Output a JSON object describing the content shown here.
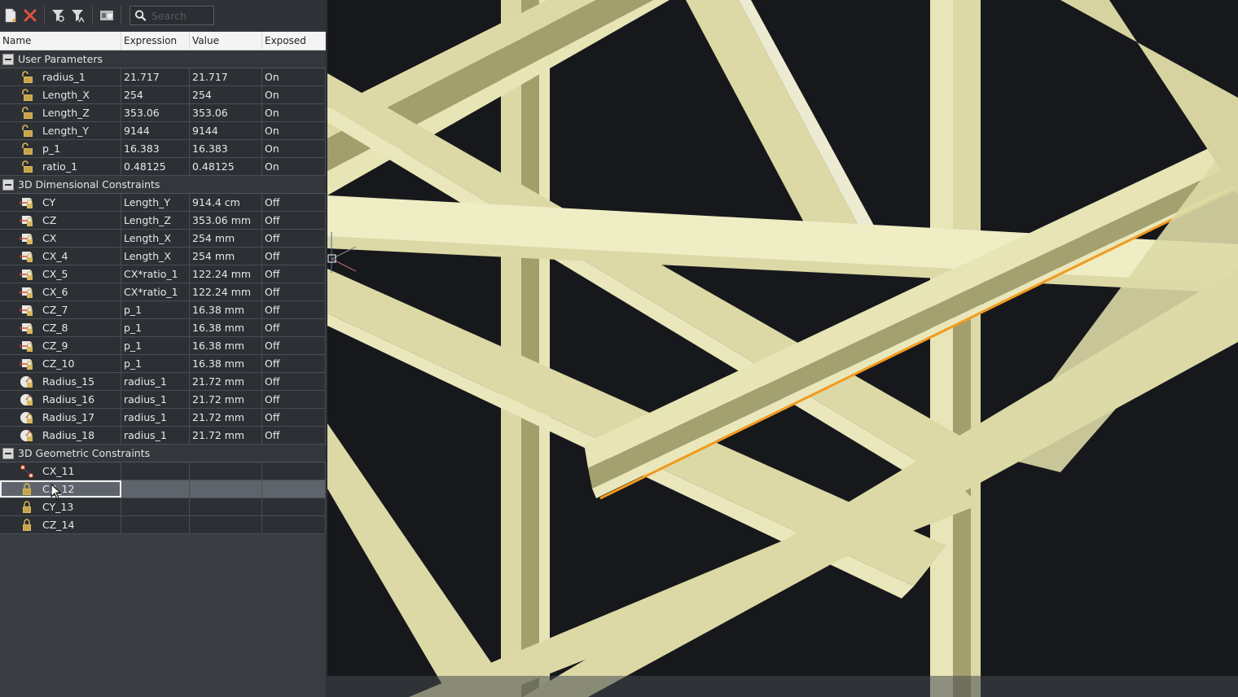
{
  "toolbar": {
    "buttons": [
      {
        "name": "new-parameter",
        "icon": "new-document-icon"
      },
      {
        "name": "delete",
        "icon": "delete-x-icon"
      },
      {
        "name": "filter",
        "icon": "filter-icon"
      },
      {
        "name": "filter-clear",
        "icon": "filter-clear-icon"
      },
      {
        "name": "manage",
        "icon": "manager-icon"
      }
    ],
    "search_placeholder": "Search",
    "search_value": ""
  },
  "columns": [
    "Name",
    "Expression",
    "Value",
    "Exposed"
  ],
  "groups": [
    {
      "label": "User Parameters",
      "icon": "unlocked-parameter-icon",
      "rows": [
        {
          "name": "radius_1",
          "expression": "21.717",
          "value": "21.717",
          "exposed": "On"
        },
        {
          "name": "Length_X",
          "expression": "254",
          "value": "254",
          "exposed": "On"
        },
        {
          "name": "Length_Z",
          "expression": "353.06",
          "value": "353.06",
          "exposed": "On"
        },
        {
          "name": "Length_Y",
          "expression": "9144",
          "value": "9144",
          "exposed": "On"
        },
        {
          "name": "p_1",
          "expression": "16.383",
          "value": "16.383",
          "exposed": "On"
        },
        {
          "name": "ratio_1",
          "expression": "0.48125",
          "value": "0.48125",
          "exposed": "On"
        }
      ]
    },
    {
      "label": "3D Dimensional Constraints",
      "rows": [
        {
          "name": "CY",
          "expression": "Length_Y",
          "value": "914.4 cm",
          "exposed": "Off",
          "icon": "linear-dimension-icon"
        },
        {
          "name": "CZ",
          "expression": "Length_Z",
          "value": "353.06 mm",
          "exposed": "Off",
          "icon": "linear-dimension-icon"
        },
        {
          "name": "CX",
          "expression": "Length_X",
          "value": "254 mm",
          "exposed": "Off",
          "icon": "linear-dimension-icon"
        },
        {
          "name": "CX_4",
          "expression": "Length_X",
          "value": "254 mm",
          "exposed": "Off",
          "icon": "linear-dimension-icon"
        },
        {
          "name": "CX_5",
          "expression": "CX*ratio_1",
          "value": "122.24 mm",
          "exposed": "Off",
          "icon": "linear-dimension-icon"
        },
        {
          "name": "CX_6",
          "expression": "CX*ratio_1",
          "value": "122.24 mm",
          "exposed": "Off",
          "icon": "linear-dimension-icon"
        },
        {
          "name": "CZ_7",
          "expression": "p_1",
          "value": "16.38 mm",
          "exposed": "Off",
          "icon": "linear-dimension-icon"
        },
        {
          "name": "CZ_8",
          "expression": "p_1",
          "value": "16.38 mm",
          "exposed": "Off",
          "icon": "linear-dimension-icon"
        },
        {
          "name": "CZ_9",
          "expression": "p_1",
          "value": "16.38 mm",
          "exposed": "Off",
          "icon": "linear-dimension-icon"
        },
        {
          "name": "CZ_10",
          "expression": "p_1",
          "value": "16.38 mm",
          "exposed": "Off",
          "icon": "linear-dimension-icon"
        },
        {
          "name": "Radius_15",
          "expression": "radius_1",
          "value": "21.72 mm",
          "exposed": "Off",
          "icon": "radius-dimension-icon"
        },
        {
          "name": "Radius_16",
          "expression": "radius_1",
          "value": "21.72 mm",
          "exposed": "Off",
          "icon": "radius-dimension-icon"
        },
        {
          "name": "Radius_17",
          "expression": "radius_1",
          "value": "21.72 mm",
          "exposed": "Off",
          "icon": "radius-dimension-icon"
        },
        {
          "name": "Radius_18",
          "expression": "radius_1",
          "value": "21.72 mm",
          "exposed": "Off",
          "icon": "radius-dimension-icon"
        }
      ]
    },
    {
      "label": "3D Geometric Constraints",
      "rows": [
        {
          "name": "CX_11",
          "expression": "",
          "value": "",
          "exposed": "",
          "icon": "coincident-constraint-icon"
        },
        {
          "name": "CX_12",
          "expression": "",
          "value": "",
          "exposed": "",
          "icon": "fix-lock-icon",
          "selected": true
        },
        {
          "name": "CY_13",
          "expression": "",
          "value": "",
          "exposed": "",
          "icon": "fix-lock-icon"
        },
        {
          "name": "CZ_14",
          "expression": "",
          "value": "",
          "exposed": "",
          "icon": "fix-lock-icon"
        }
      ]
    }
  ],
  "colors": {
    "beam_light": "#e9e7b9",
    "beam_mid": "#d7d4a2",
    "beam_dark": "#a29f6c",
    "highlight_edge": "#f39a1e",
    "viewport_bg": "#16181b"
  }
}
